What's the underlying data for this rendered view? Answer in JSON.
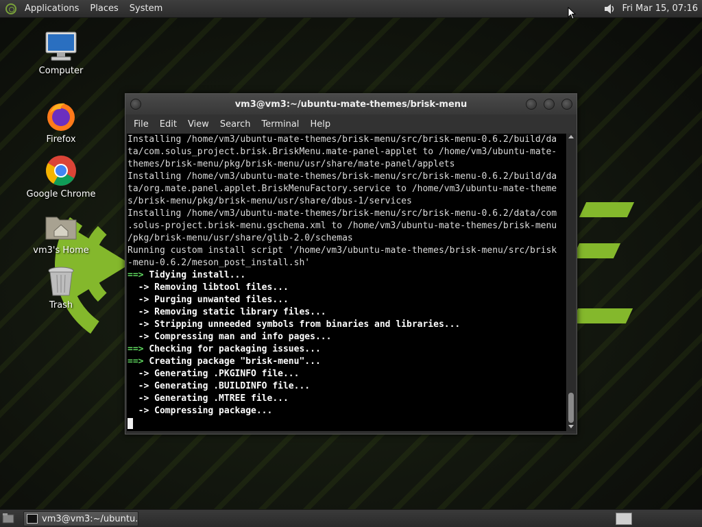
{
  "top_panel": {
    "menus": [
      "Applications",
      "Places",
      "System"
    ],
    "clock": "Fri Mar 15, 07:16"
  },
  "desktop_icons": [
    {
      "label": "Computer",
      "icon": "computer-icon"
    },
    {
      "label": "Firefox",
      "icon": "firefox-icon"
    },
    {
      "label": "Google Chrome",
      "icon": "chrome-icon"
    },
    {
      "label": "vm3's Home",
      "icon": "home-folder-icon"
    },
    {
      "label": "Trash",
      "icon": "trash-icon"
    }
  ],
  "terminal": {
    "title": "vm3@vm3:~/ubuntu-mate-themes/brisk-menu",
    "menus": [
      "File",
      "Edit",
      "View",
      "Search",
      "Terminal",
      "Help"
    ],
    "lines": [
      {
        "p": "",
        "t": "Installing /home/vm3/ubuntu-mate-themes/brisk-menu/src/brisk-menu-0.6.2/build/da"
      },
      {
        "p": "",
        "t": "ta/com.solus_project.brisk.BriskMenu.mate-panel-applet to /home/vm3/ubuntu-mate-"
      },
      {
        "p": "",
        "t": "themes/brisk-menu/pkg/brisk-menu/usr/share/mate-panel/applets"
      },
      {
        "p": "",
        "t": "Installing /home/vm3/ubuntu-mate-themes/brisk-menu/src/brisk-menu-0.6.2/build/da"
      },
      {
        "p": "",
        "t": "ta/org.mate.panel.applet.BriskMenuFactory.service to /home/vm3/ubuntu-mate-theme"
      },
      {
        "p": "",
        "t": "s/brisk-menu/pkg/brisk-menu/usr/share/dbus-1/services"
      },
      {
        "p": "",
        "t": "Installing /home/vm3/ubuntu-mate-themes/brisk-menu/src/brisk-menu-0.6.2/data/com"
      },
      {
        "p": "",
        "t": ".solus-project.brisk-menu.gschema.xml to /home/vm3/ubuntu-mate-themes/brisk-menu"
      },
      {
        "p": "",
        "t": "/pkg/brisk-menu/usr/share/glib-2.0/schemas"
      },
      {
        "p": "",
        "t": "Running custom install script '/home/vm3/ubuntu-mate-themes/brisk-menu/src/brisk"
      },
      {
        "p": "",
        "t": "-menu-0.6.2/meson_post_install.sh'"
      },
      {
        "p": "==>",
        "t": "Tidying install..."
      },
      {
        "p": "  ->",
        "t": "Removing libtool files..."
      },
      {
        "p": "  ->",
        "t": "Purging unwanted files..."
      },
      {
        "p": "  ->",
        "t": "Removing static library files..."
      },
      {
        "p": "  ->",
        "t": "Stripping unneeded symbols from binaries and libraries..."
      },
      {
        "p": "  ->",
        "t": "Compressing man and info pages..."
      },
      {
        "p": "==>",
        "t": "Checking for packaging issues..."
      },
      {
        "p": "==>",
        "t": "Creating package \"brisk-menu\"..."
      },
      {
        "p": "  ->",
        "t": "Generating .PKGINFO file..."
      },
      {
        "p": "  ->",
        "t": "Generating .BUILDINFO file..."
      },
      {
        "p": "  ->",
        "t": "Generating .MTREE file..."
      },
      {
        "p": "  ->",
        "t": "Compressing package..."
      }
    ]
  },
  "bottom_panel": {
    "task_label": "vm3@vm3:~/ubuntu..."
  },
  "colors": {
    "accent_green": "#84b82c",
    "prompt_green": "#5fd75f",
    "terminal_bg": "#000000"
  }
}
